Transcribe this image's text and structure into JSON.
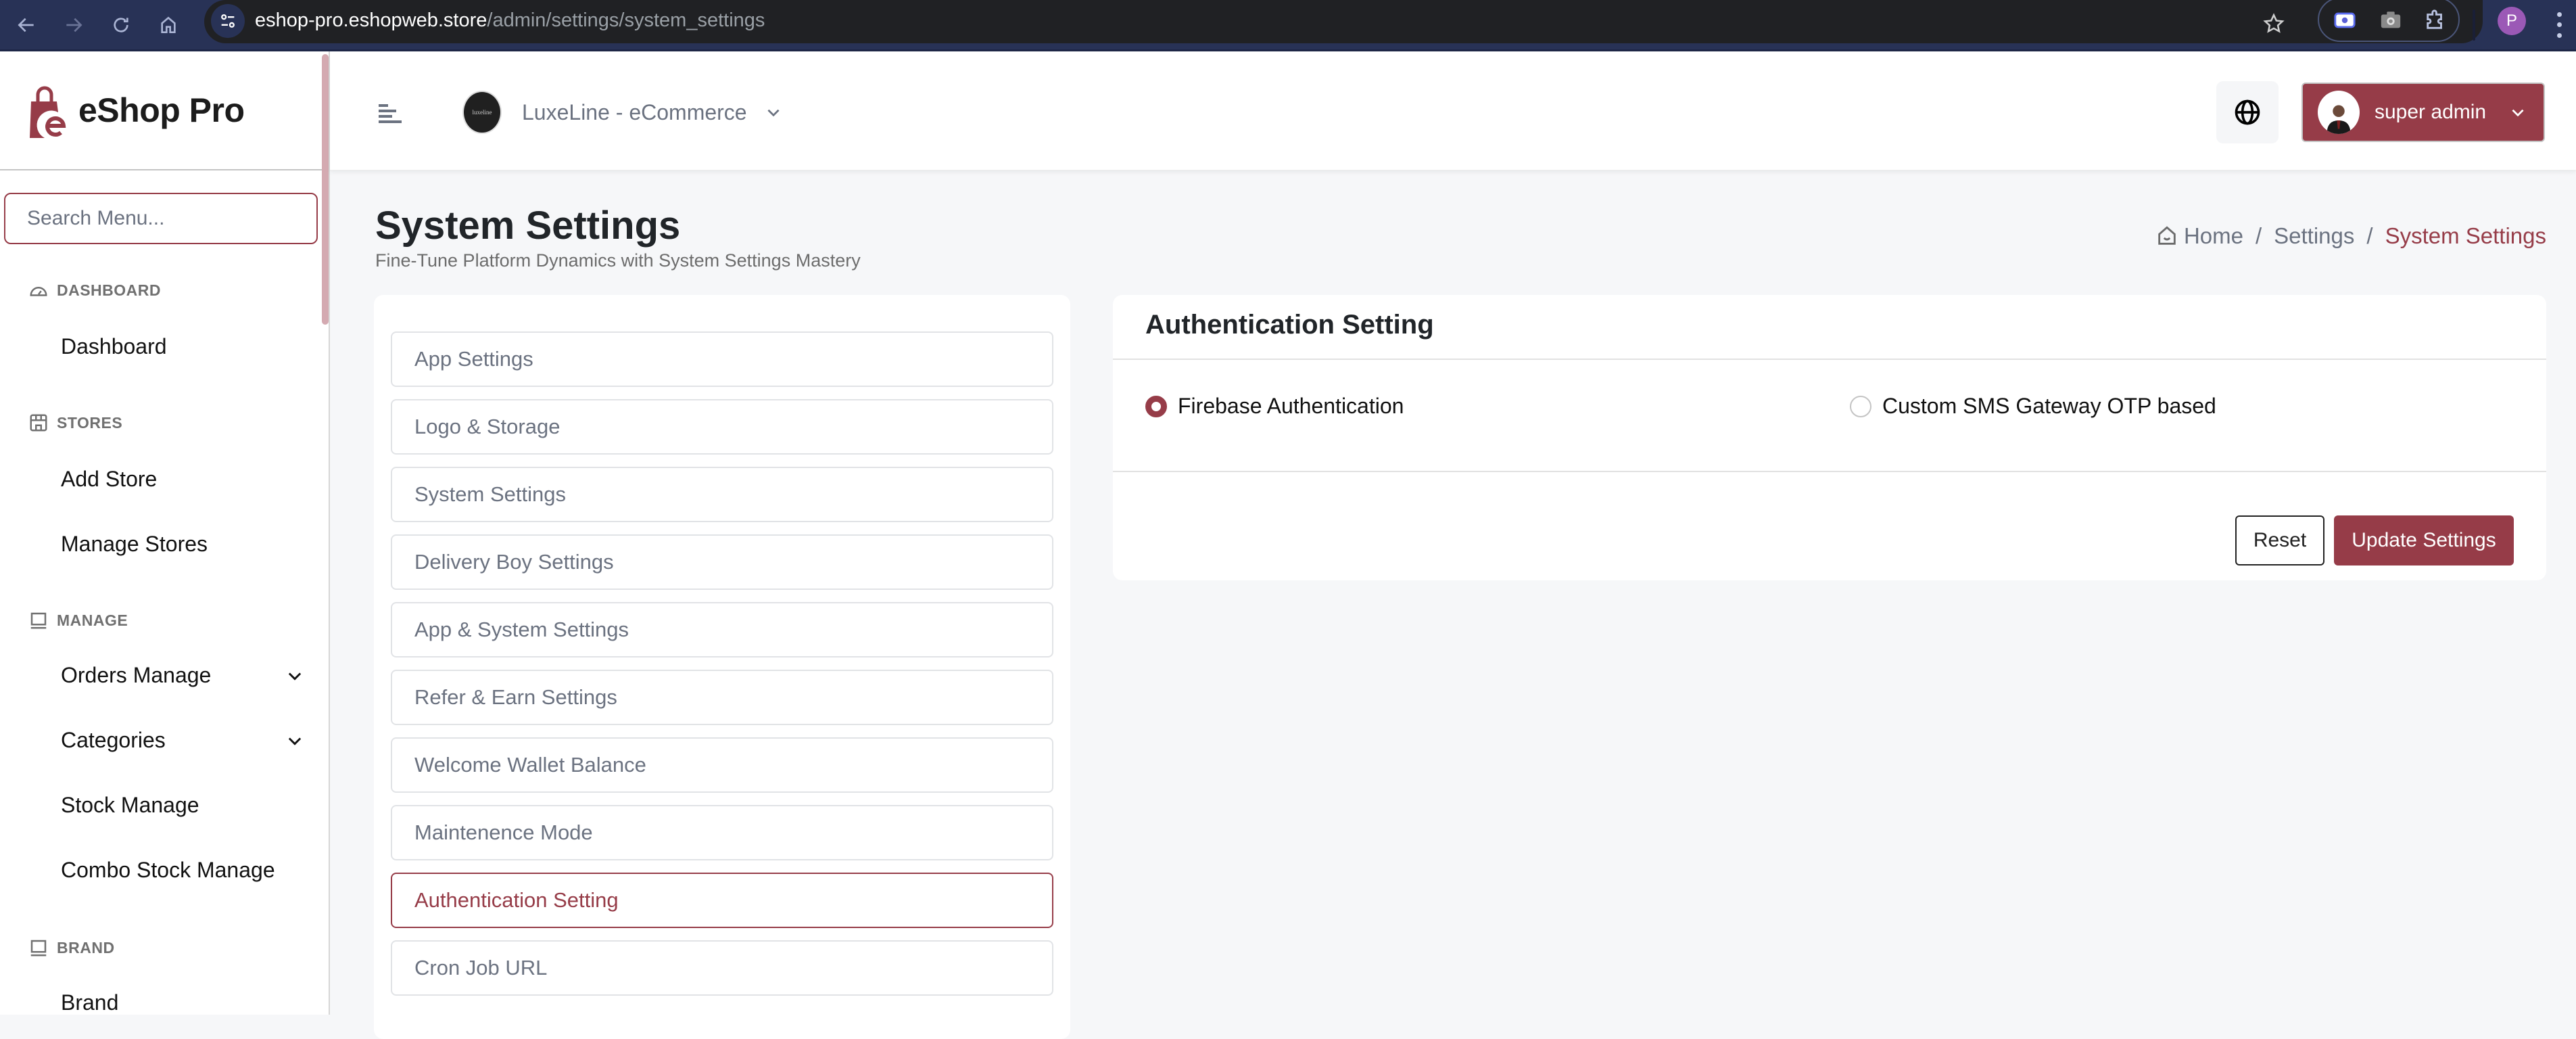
{
  "browser": {
    "url_host": "eshop-pro.eshopweb.store",
    "url_path": "/admin/settings/system_settings",
    "profile_initial": "P"
  },
  "brand": {
    "name": "eShop Pro",
    "accent_color": "#963c48"
  },
  "sidebar": {
    "search_placeholder": "Search Menu...",
    "sections": [
      {
        "title": "DASHBOARD",
        "icon": "gauge-icon",
        "items": [
          {
            "label": "Dashboard",
            "has_submenu": false
          }
        ]
      },
      {
        "title": "STORES",
        "icon": "store-icon",
        "items": [
          {
            "label": "Add Store",
            "has_submenu": false
          },
          {
            "label": "Manage Stores",
            "has_submenu": false
          }
        ]
      },
      {
        "title": "MANAGE",
        "icon": "laptop-icon",
        "items": [
          {
            "label": "Orders Manage",
            "has_submenu": true
          },
          {
            "label": "Categories",
            "has_submenu": true
          },
          {
            "label": "Stock Manage",
            "has_submenu": false
          },
          {
            "label": "Combo Stock Manage",
            "has_submenu": false
          }
        ]
      },
      {
        "title": "BRAND",
        "icon": "laptop-icon",
        "items": [
          {
            "label": "Brand",
            "has_submenu": false
          }
        ]
      }
    ]
  },
  "header": {
    "store_name": "LuxeLine - eCommerce",
    "store_logo_text": "luxeline",
    "user_name": "super admin"
  },
  "page": {
    "title": "System Settings",
    "subtitle": "Fine-Tune Platform Dynamics with System Settings Mastery",
    "breadcrumb": [
      "Home",
      "Settings",
      "System Settings"
    ]
  },
  "settings_menu": {
    "items": [
      {
        "label": "App Settings",
        "active": false
      },
      {
        "label": "Logo & Storage",
        "active": false
      },
      {
        "label": "System Settings",
        "active": false
      },
      {
        "label": "Delivery Boy Settings",
        "active": false
      },
      {
        "label": "App & System Settings",
        "active": false
      },
      {
        "label": "Refer & Earn Settings",
        "active": false
      },
      {
        "label": "Welcome Wallet Balance",
        "active": false
      },
      {
        "label": "Maintenence Mode",
        "active": false
      },
      {
        "label": "Authentication Setting",
        "active": true
      },
      {
        "label": "Cron Job URL",
        "active": false
      }
    ]
  },
  "auth_setting": {
    "title": "Authentication Setting",
    "options": [
      {
        "label": "Firebase Authentication",
        "checked": true
      },
      {
        "label": "Custom SMS Gateway OTP based",
        "checked": false
      }
    ],
    "reset_label": "Reset",
    "update_label": "Update Settings"
  }
}
